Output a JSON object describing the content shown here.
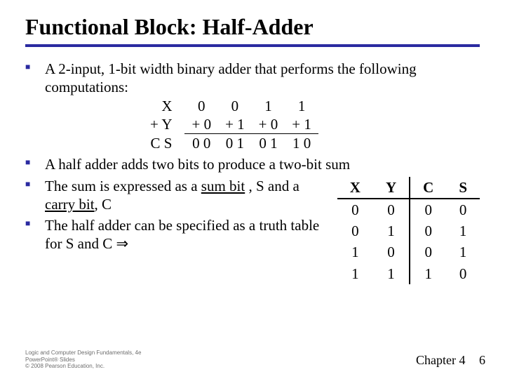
{
  "title": "Functional Block: Half-Adder",
  "b1": "A 2-input, 1-bit width binary adder that performs the following computations:",
  "comp": {
    "r1": {
      "lbl": "X",
      "c1": "0",
      "c2": "0",
      "c3": "1",
      "c4": "1"
    },
    "r2": {
      "lbl": "+ Y",
      "c1": "+ 0",
      "c2": "+ 1",
      "c3": "+ 0",
      "c4": "+ 1"
    },
    "r3": {
      "lbl": "C S",
      "c1": "0  0",
      "c2": "0  1",
      "c3": "0  1",
      "c4": "1  0"
    }
  },
  "b2": "A half adder adds two bits to produce a two-bit sum",
  "b3p1": "The sum is expressed as a ",
  "b3u1": "sum bit",
  "b3p2": " , S and a ",
  "b3u2": "carry bit",
  "b3p3": ", C",
  "b4": "The half adder can be specified as a truth table for S and C  ⇒",
  "tt": {
    "h": {
      "x": "X",
      "y": "Y",
      "c": "C",
      "s": "S"
    },
    "r": [
      {
        "x": "0",
        "y": "0",
        "c": "0",
        "s": "0"
      },
      {
        "x": "0",
        "y": "1",
        "c": "0",
        "s": "1"
      },
      {
        "x": "1",
        "y": "0",
        "c": "0",
        "s": "1"
      },
      {
        "x": "1",
        "y": "1",
        "c": "1",
        "s": "0"
      }
    ]
  },
  "footer": {
    "l1": "Logic and Computer Design Fundamentals, 4e",
    "l2": "PowerPoint® Slides",
    "l3": "© 2008 Pearson Education, Inc.",
    "chapter": "Chapter 4",
    "page": "6"
  }
}
